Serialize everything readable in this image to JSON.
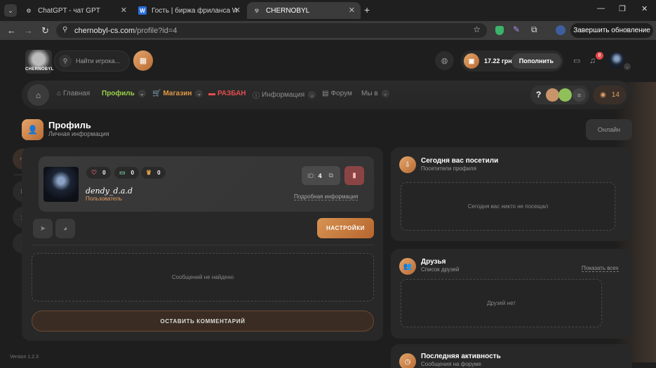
{
  "browser": {
    "tabs": [
      {
        "title": "ChatGPT - чат GPT"
      },
      {
        "title": "Гость | биржа фриланса Webl..."
      },
      {
        "title": "CHERNOBYL"
      }
    ],
    "url_host": "chernobyl-cs.com",
    "url_path": "/profile?id=4",
    "update_button": "Завершить обновление"
  },
  "header": {
    "logo_text": "CHERNOBYL",
    "search_placeholder": "Найти игрока...",
    "balance": "17.22 грн",
    "topup": "Пополнить",
    "notifications_count": "8"
  },
  "nav": {
    "items": [
      {
        "label": "Главная"
      },
      {
        "label": "Профиль"
      },
      {
        "label": "Магазин"
      },
      {
        "label": "РАЗБАН"
      },
      {
        "label": "Информация"
      },
      {
        "label": "Форум"
      },
      {
        "label": "Мы в"
      }
    ],
    "help": "?",
    "online_count": "14"
  },
  "profile": {
    "title": "Профиль",
    "subtitle": "Личная информация",
    "status": "Онлайн",
    "username": "dendy_d.a.d",
    "role": "Пользователь",
    "likes": "0",
    "comments": "0",
    "trophies": "0",
    "id_label": "ID:",
    "id_value": "4",
    "details_link": "Подробная информация",
    "settings_button": "НАСТРОЙКИ",
    "no_messages": "Сообщений не найдено",
    "comment_button": "ОСТАВИТЬ КОММЕНТАРИЙ"
  },
  "visitors": {
    "title": "Сегодня вас посетили",
    "subtitle": "Посетители профиля",
    "empty": "Сегодня вас никто не посещал"
  },
  "friends": {
    "title": "Друзья",
    "subtitle": "Список друзей",
    "show_all": "Показать всех",
    "empty": "Друзей нет"
  },
  "activity": {
    "title": "Последняя активность",
    "subtitle": "Сообщения на форуме"
  },
  "version": "Version 1.2.3",
  "colors": {
    "accent": "#d99559",
    "nav_active": "#9ad24a",
    "shop": "#e39a44",
    "unban": "#e34c4c"
  }
}
